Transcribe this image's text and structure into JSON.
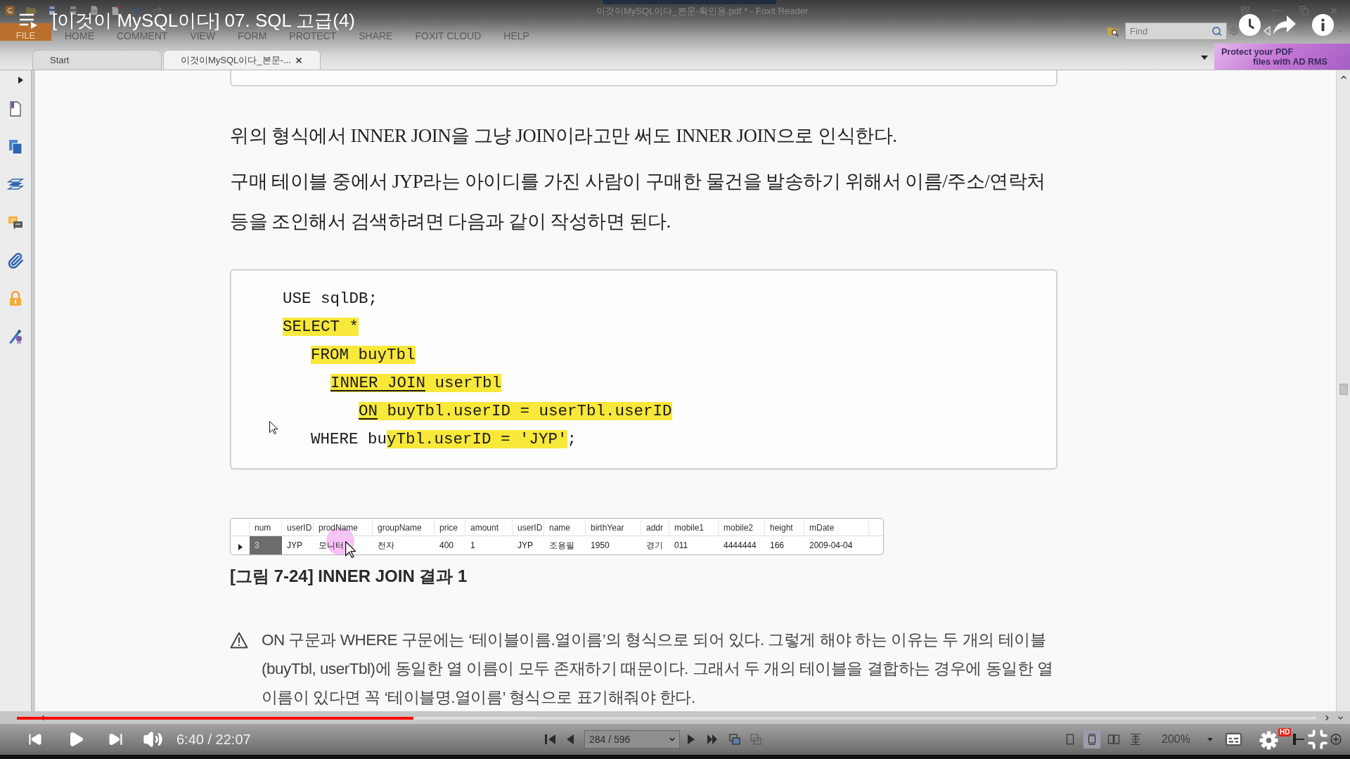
{
  "player": {
    "title": "[이것이 MySQL이다] 07. SQL 고급(4)",
    "playing": false,
    "progress": {
      "level": 0.305,
      "buffer": {
        "level": 0.399
      }
    },
    "time": "6:40 / 22:07",
    "quality_badge": "HD"
  },
  "app": {
    "window_title": "이것이MySQL이다_본문-확인용.pdf * - Foxit Reader",
    "menu": [
      {
        "label": "FILE",
        "selected": true
      },
      {
        "label": "HOME",
        "selected": false
      },
      {
        "label": "COMMENT",
        "selected": false
      },
      {
        "label": "VIEW",
        "selected": false
      },
      {
        "label": "FORM",
        "selected": false
      },
      {
        "label": "PROTECT",
        "selected": false
      },
      {
        "label": "SHARE",
        "selected": false
      },
      {
        "label": "FOXIT CLOUD",
        "selected": false
      },
      {
        "label": "HELP",
        "selected": false
      }
    ],
    "find": {
      "placeholder": "Find"
    },
    "tabs": [
      {
        "label": "Start",
        "selected": false,
        "closable": false
      },
      {
        "label": "이것이MySQL이다_본문-...",
        "selected": true,
        "closable": true
      }
    ],
    "banner": {
      "lines": [
        "Protect your PDF",
        "files with AD RMS"
      ]
    }
  },
  "document": {
    "paragraphs": [
      "위의 형식에서 INNER JOIN을 그냥 JOIN이라고만 써도 INNER JOIN으로 인식한다.",
      "구매 테이블 중에서 JYP라는 아이디를 가진 사람이 구매한 물건을 발송하기 위해서 이름/주소/연락처 등을 조인해서 검색하려면 다음과 같이 작성하면 된다."
    ],
    "code": [
      {
        "segments": [
          {
            "text": "USE sqlDB;",
            "highlighted": false,
            "underlined": false
          }
        ]
      },
      {
        "segments": [
          {
            "text": "SELECT *",
            "highlighted": true,
            "underlined": false
          }
        ],
        "children": [
          {
            "segments": [
              {
                "text": "FROM buyTbl",
                "highlighted": true,
                "underlined": false
              }
            ],
            "children": [
              {
                "segments": [
                  {
                    "text": "INNER JOIN",
                    "highlighted": true,
                    "underlined": true
                  },
                  {
                    "text": " userTbl",
                    "highlighted": true,
                    "underlined": false
                  }
                ],
                "children": [
                  {
                    "segments": [
                      {
                        "text": "ON",
                        "highlighted": true,
                        "underlined": true
                      },
                      {
                        "text": " buyTbl.userID = userTbl.userID",
                        "highlighted": true,
                        "underlined": false
                      }
                    ]
                  }
                ]
              }
            ]
          },
          {
            "segments": [
              {
                "text": "WHERE bu",
                "highlighted": false,
                "underlined": false
              },
              {
                "text": "yTbl.userID = 'JYP'",
                "highlighted": true,
                "underlined": false
              },
              {
                "text": ";",
                "highlighted": false,
                "underlined": false
              }
            ]
          }
        ]
      }
    ],
    "result_table": {
      "columns": [
        "num",
        "userID",
        "prodName",
        "groupName",
        "price",
        "amount",
        "userID",
        "name",
        "birthYear",
        "addr",
        "mobile1",
        "mobile2",
        "height",
        "mDate"
      ],
      "rows": [
        {
          "current": true,
          "cells": [
            {
              "text": "3",
              "selected": true
            },
            {
              "text": "JYP",
              "selected": false
            },
            {
              "text": "모니터",
              "selected": false
            },
            {
              "text": "전자",
              "selected": false
            },
            {
              "text": "400",
              "selected": false
            },
            {
              "text": "1",
              "selected": false
            },
            {
              "text": "JYP",
              "selected": false
            },
            {
              "text": "조용필",
              "selected": false
            },
            {
              "text": "1950",
              "selected": false
            },
            {
              "text": "경기",
              "selected": false
            },
            {
              "text": "011",
              "selected": false
            },
            {
              "text": "4444444",
              "selected": false
            },
            {
              "text": "166",
              "selected": false
            },
            {
              "text": "2009-04-04",
              "selected": false
            }
          ]
        }
      ]
    },
    "caption": "[그림 7-24] INNER JOIN 결과 1",
    "note": "ON 구문과 WHERE 구문에는 ‘테이블이름.열이름’의 형식으로 되어 있다. 그렇게 해야 하는 이유는 두 개의 테이블(buyTbl, userTbl)에 동일한 열 이름이 모두 존재하기 때문이다. 그래서 두 개의 테이블을 결합하는 경우에 동일한 열 이름이 있다면 꼭 ‘테이블명.열이름’ 형식으로 표기해줘야 한다."
  },
  "status_bar": {
    "page": "284 / 596",
    "view_modes": [
      {
        "selected": false
      },
      {
        "selected": true
      },
      {
        "selected": false
      },
      {
        "selected": false
      }
    ],
    "zoom": "200%",
    "zoom_slider": {
      "level": 0.12
    }
  }
}
